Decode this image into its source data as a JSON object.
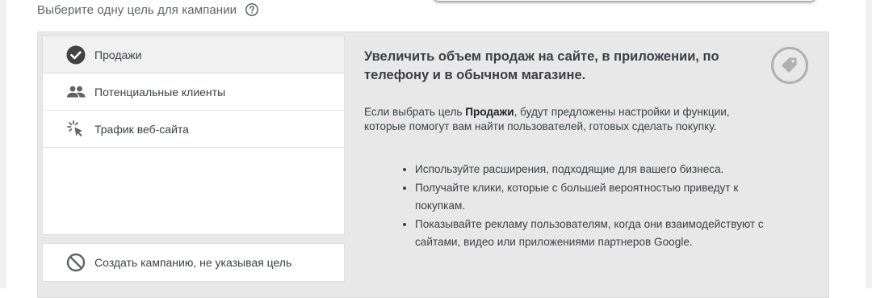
{
  "heading": {
    "text": "Выберите одну цель для кампании",
    "help_icon": "help-circle-icon"
  },
  "goals": [
    {
      "label": "Продажи",
      "icon": "check-circle-icon",
      "selected": true
    },
    {
      "label": "Потенциальные клиенты",
      "icon": "people-icon",
      "selected": false
    },
    {
      "label": "Трафик веб-сайта",
      "icon": "cursor-click-icon",
      "selected": false
    }
  ],
  "no_goal": {
    "label": "Создать кампанию, не указывая цель",
    "icon": "block-icon"
  },
  "detail": {
    "title": "Увеличить объем продаж на сайте, в приложении, по телефону и в обычном магазине.",
    "icon": "tag-icon",
    "desc_prefix": "Если выбрать цель ",
    "desc_bold": "Продажи",
    "desc_suffix": ", будут предложены настройки и функции, которые помогут вам найти пользователей, готовых сделать покупку.",
    "bullets": [
      "Используйте расширения, подходящие для вашего бизнеса.",
      "Получайте клики, которые с большей вероятностью приведут к покупкам.",
      "Показывайте рекламу пользователям, когда они взаимодействуют с сайтами, видео или приложениями партнеров Google."
    ]
  },
  "colors": {
    "panel_bg": "#e8e8e8",
    "selected_bg": "#f1f1f1",
    "icon_dark": "#5f6368",
    "icon_selected": "#424242",
    "tag_icon": "#b0b0b0"
  }
}
